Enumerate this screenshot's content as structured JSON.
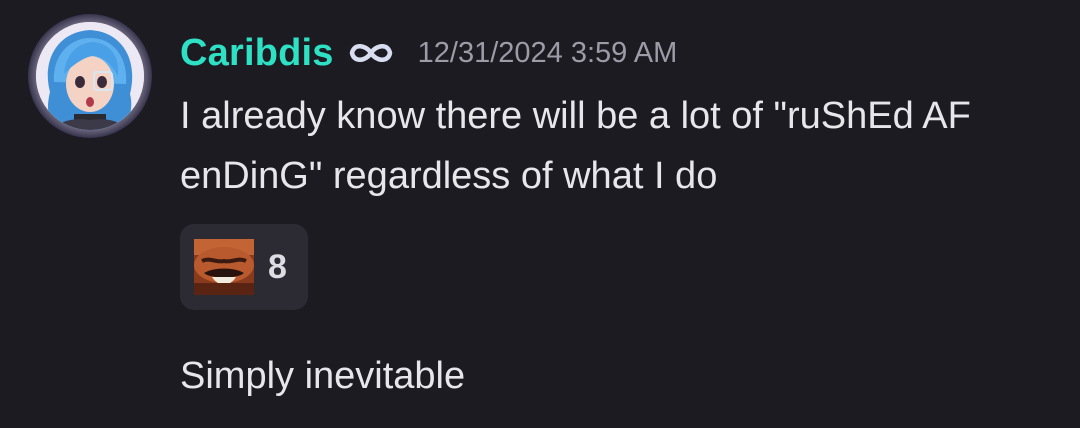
{
  "message": {
    "author": {
      "name": "Caribdis",
      "name_color": "#2ee0c4",
      "badge_icon": "infinity-icon",
      "avatar_icon": "avatar-blue-haired-girl"
    },
    "timestamp": "12/31/2024 3:59 AM",
    "text": "I already know there will be a lot of \"ruShEd AF enDinG\" regardless of what I do",
    "reaction": {
      "emoji_icon": "laughing-man-emoji",
      "count": "8"
    },
    "followup_text": "Simply inevitable"
  },
  "colors": {
    "background": "#1c1b22",
    "reaction_bg": "#2c2b33",
    "timestamp": "#9c9ba6",
    "text": "#e6e6eb"
  }
}
